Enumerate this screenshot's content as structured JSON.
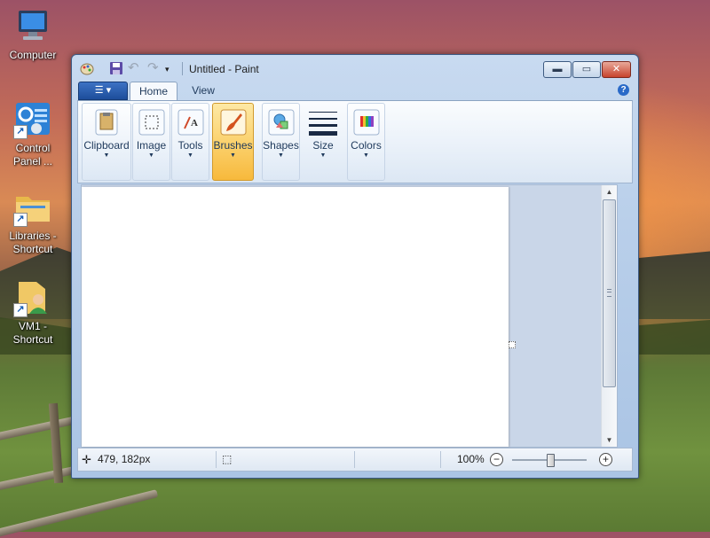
{
  "desktop": {
    "icons": [
      {
        "label": "Computer",
        "icon": "computer-icon"
      },
      {
        "label": "Control Panel ...",
        "icon": "control-panel-icon"
      },
      {
        "label": "Libraries - Shortcut",
        "icon": "libraries-folder-icon"
      },
      {
        "label": "VM1 - Shortcut",
        "icon": "user-folder-icon"
      }
    ]
  },
  "window": {
    "title": "Untitled - Paint",
    "caption_buttons": {
      "minimize": "minimize",
      "maximize": "maximize",
      "close": "close"
    },
    "tabs": [
      {
        "label": "Home",
        "active": true
      },
      {
        "label": "View",
        "active": false
      }
    ],
    "ribbon_groups": [
      {
        "label": "Clipboard",
        "icon": "clipboard-icon",
        "selected": false
      },
      {
        "label": "Image",
        "icon": "select-icon",
        "selected": false
      },
      {
        "label": "Tools",
        "icon": "tools-icon",
        "selected": false
      },
      {
        "label": "Brushes",
        "icon": "brush-icon",
        "selected": true
      },
      {
        "label": "Shapes",
        "icon": "shapes-icon",
        "selected": false
      },
      {
        "label": "Size",
        "icon": "size-lines-icon",
        "selected": false
      },
      {
        "label": "Colors",
        "icon": "palette-icon",
        "selected": false
      }
    ],
    "status": {
      "cursor_position": "479, 182px",
      "zoom": "100%",
      "zoom_level_fraction": 0.5
    }
  }
}
